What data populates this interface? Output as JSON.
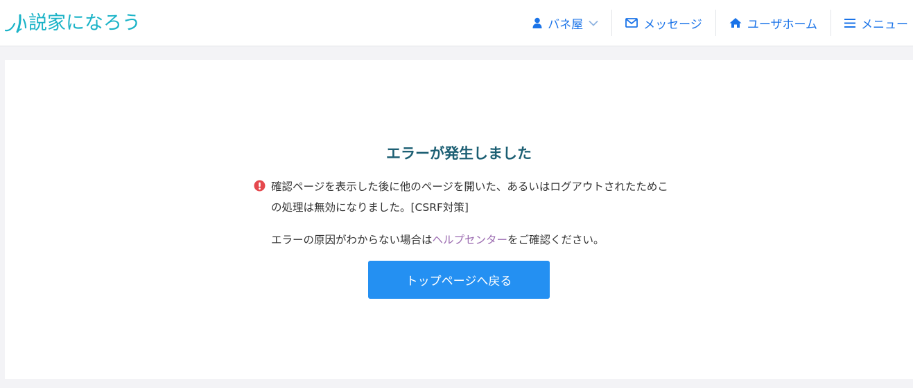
{
  "header": {
    "logo_text": "説家になろう",
    "nav": {
      "user_name": "バネ屋",
      "messages_label": "メッセージ",
      "user_home_label": "ユーザホーム",
      "menu_label": "メニュー"
    },
    "icons": {
      "logo": "logo-mark-icon",
      "user": "user-icon",
      "chevron": "chevron-down-icon",
      "messages": "envelope-icon",
      "home": "home-icon",
      "menu": "hamburger-icon"
    }
  },
  "error": {
    "title": "エラーが発生しました",
    "message": "確認ページを表示した後に他のページを開いた、あるいはログアウトされたためこの処理は無効になりました。[CSRF対策]",
    "help_prefix": "エラーの原因がわからない場合は",
    "help_link": "ヘルプセンター",
    "help_suffix": "をご確認ください。",
    "alert_icon": "exclamation-circle-icon"
  },
  "button": {
    "label": "トップページへ戻る"
  },
  "colors": {
    "accent": "#1a73e8",
    "logo": "#1ab3c7",
    "title": "#1c5f73",
    "button": "#2490f2",
    "alert": "#e5484d",
    "link": "#9b6bb0",
    "page_background": "#f3f3f6"
  }
}
